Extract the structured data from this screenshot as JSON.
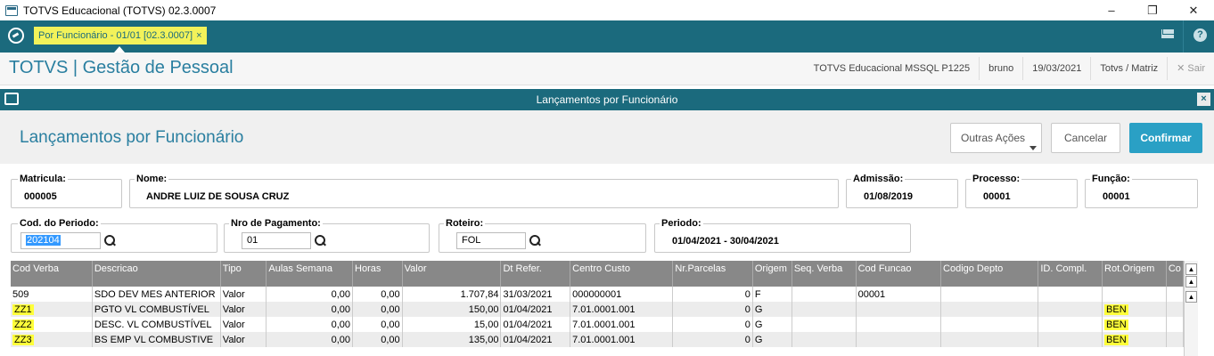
{
  "window": {
    "title": "TOTVS Educacional (TOTVS) 02.3.0007",
    "minimize": "–",
    "maximize": "❐",
    "close": "✕"
  },
  "topbar": {
    "tab_label": "Por Funcionário - 01/01 [02.3.0007]",
    "tab_close": "×",
    "help": "?"
  },
  "header": {
    "brand": "TOTVS | Gestão de Pessoal",
    "environment": "TOTVS Educacional MSSQL P1225",
    "user": "bruno",
    "date": "19/03/2021",
    "branch": "Totvs / Matriz",
    "exit": "✕  Sair"
  },
  "dialog": {
    "title": "Lançamentos por Funcionário",
    "close": "×",
    "heading": "Lançamentos por Funcionário",
    "buttons": {
      "other_actions": "Outras Ações",
      "cancel": "Cancelar",
      "confirm": "Confirmar"
    }
  },
  "fields": {
    "matricula": {
      "label": "Matricula:",
      "value": "000005"
    },
    "nome": {
      "label": "Nome:",
      "value": "ANDRE LUIZ DE SOUSA CRUZ"
    },
    "admissao": {
      "label": "Admissão:",
      "value": "01/08/2019"
    },
    "processo": {
      "label": "Processo:",
      "value": "00001"
    },
    "funcao": {
      "label": "Função:",
      "value": "00001"
    },
    "cod_periodo": {
      "label": "Cod. do Periodo:",
      "value": "202104"
    },
    "nro_pagamento": {
      "label": "Nro de Pagamento:",
      "value": "01"
    },
    "roteiro": {
      "label": "Roteiro:",
      "value": "FOL"
    },
    "periodo": {
      "label": "Periodo:",
      "value": "01/04/2021 - 30/04/2021"
    }
  },
  "grid": {
    "columns": [
      "Cod Verba",
      "Descricao",
      "Tipo",
      "Aulas Semana",
      "Horas",
      "Valor",
      "Dt Refer.",
      "Centro Custo",
      "Nr.Parcelas",
      "Origem",
      "Seq. Verba",
      "Cod Funcao",
      "Codigo Depto",
      "ID. Compl.",
      "Rot.Origem",
      "Co"
    ],
    "rows": [
      [
        "509",
        "SDO DEV MES ANTERIOR",
        "Valor",
        "0,00",
        "0,00",
        "1.707,84",
        "31/03/2021",
        "000000001",
        "0",
        "F",
        "",
        "00001",
        "",
        "",
        "",
        ""
      ],
      [
        "ZZ1",
        "PGTO VL COMBUSTÍVEL",
        "Valor",
        "0,00",
        "0,00",
        "150,00",
        "01/04/2021",
        "7.01.0001.001",
        "0",
        "G",
        "",
        "",
        "",
        "",
        "BEN",
        ""
      ],
      [
        "ZZ2",
        "DESC. VL COMBUSTÍVEL",
        "Valor",
        "0,00",
        "0,00",
        "15,00",
        "01/04/2021",
        "7.01.0001.001",
        "0",
        "G",
        "",
        "",
        "",
        "",
        "BEN",
        ""
      ],
      [
        "ZZ3",
        "BS EMP VL COMBUSTIVE",
        "Valor",
        "0,00",
        "0,00",
        "135,00",
        "01/04/2021",
        "7.01.0001.001",
        "0",
        "G",
        "",
        "",
        "",
        "",
        "BEN",
        ""
      ]
    ],
    "highlight_color": "#ffff3a"
  }
}
